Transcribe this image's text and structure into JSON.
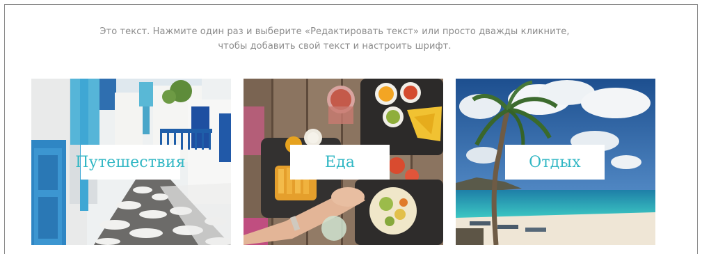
{
  "intro": {
    "line1": "Это текст. Нажмите один раз и выберите «Редактировать текст» или просто дважды кликните,",
    "line2": "чтобы добавить свой текст и настроить шрифт."
  },
  "cards": [
    {
      "label": "Путешествия",
      "photo": "white-greek-street-photo"
    },
    {
      "label": "Еда",
      "photo": "food-table-photo"
    },
    {
      "label": "Отдых",
      "photo": "tropical-beach-palm-photo"
    }
  ],
  "colors": {
    "accent": "#31b7c4",
    "text_gray": "#8b8b8b",
    "label_bg": "#ffffff"
  }
}
